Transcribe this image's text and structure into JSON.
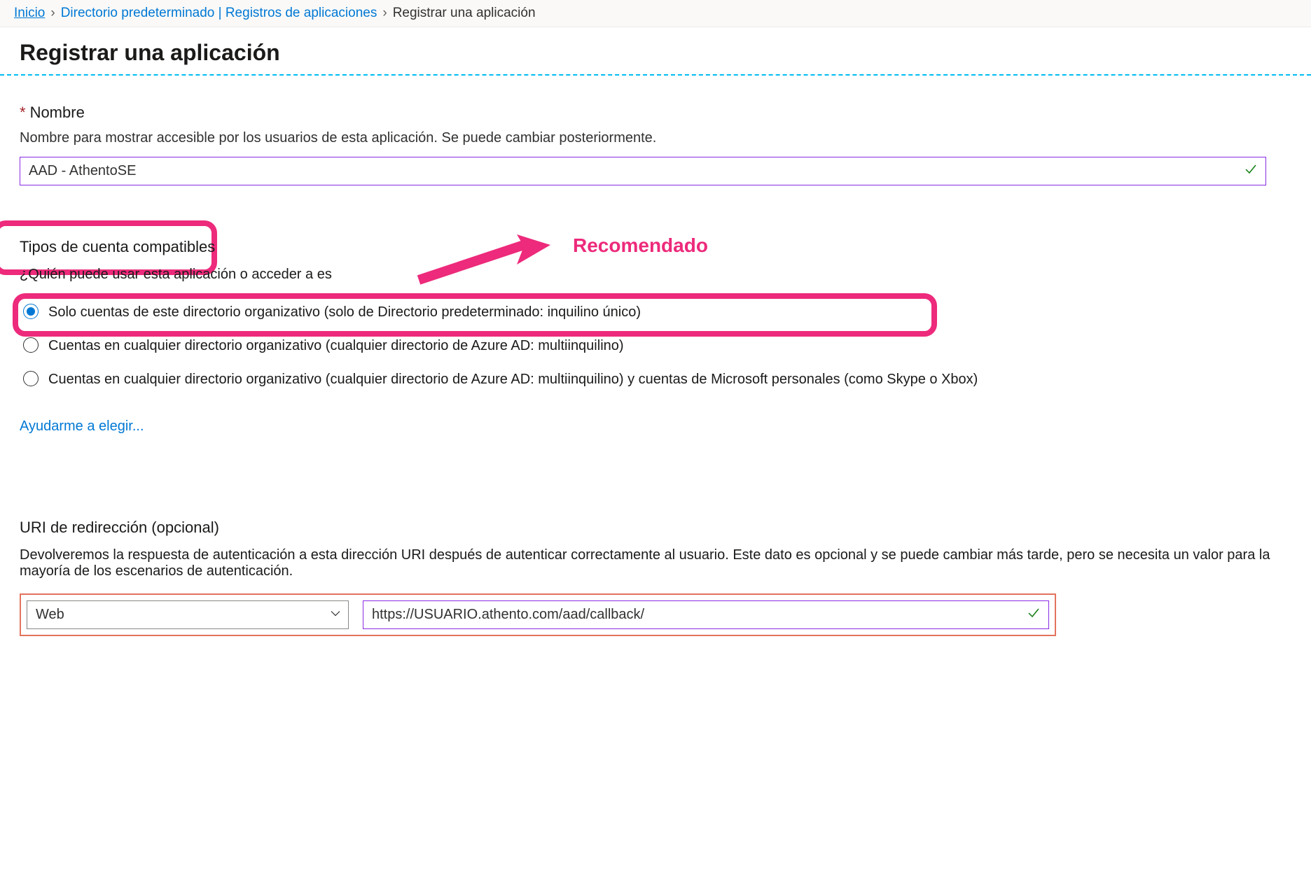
{
  "breadcrumb": {
    "home": "Inicio",
    "middle": "Directorio predeterminado | Registros de aplicaciones",
    "current": "Registrar una aplicación"
  },
  "page_title": "Registrar una aplicación",
  "name_field": {
    "label": "Nombre",
    "hint": "Nombre para mostrar accesible por los usuarios de esta aplicación. Se puede cambiar posteriormente.",
    "value": "AAD - AthentoSE"
  },
  "account_types": {
    "title": "Tipos de cuenta compatibles",
    "subtitle_prefix": "¿Quién puede usar esta aplicación o acceder a es",
    "options": [
      "Solo cuentas de este directorio organizativo (solo de Directorio predeterminado: inquilino único)",
      "Cuentas en cualquier directorio organizativo (cualquier directorio de Azure AD: multiinquilino)",
      "Cuentas en cualquier directorio organizativo (cualquier directorio de Azure AD: multiinquilino) y cuentas de Microsoft personales (como Skype o Xbox)"
    ],
    "help_link": "Ayudarme a elegir..."
  },
  "annotation": {
    "label": "Recomendado"
  },
  "redirect_uri": {
    "title": "URI de redirección (opcional)",
    "description": "Devolveremos la respuesta de autenticación a esta dirección URI después de autenticar correctamente al usuario. Este dato es opcional y se puede cambiar más tarde, pero se necesita un valor para la mayoría de los escenarios de autenticación.",
    "platform": "Web",
    "value": "https://USUARIO.athento.com/aad/callback/"
  }
}
